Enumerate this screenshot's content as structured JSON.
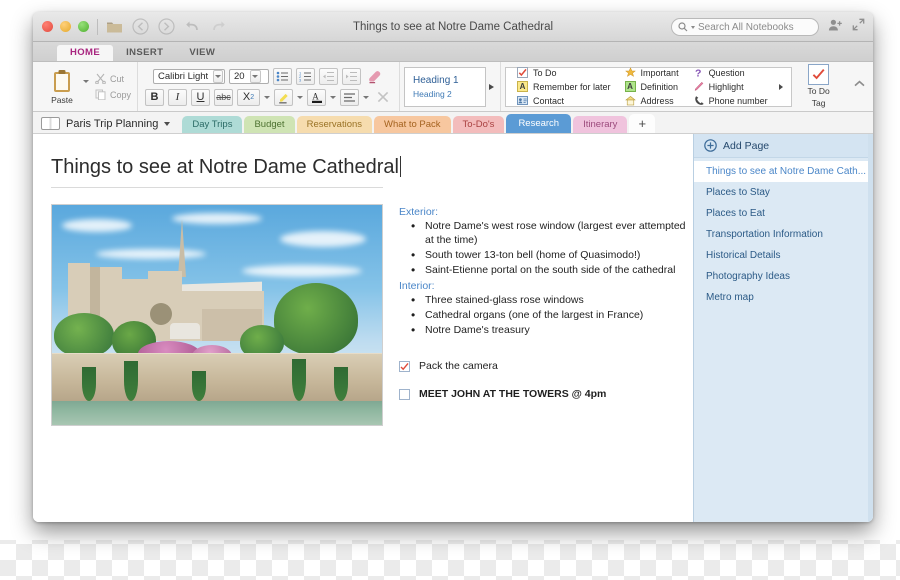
{
  "window": {
    "title": "Things to see at Notre Dame Cathedral",
    "traffic": {
      "close": "close-button",
      "minimize": "minimize-button",
      "maximize": "maximize-button"
    }
  },
  "titlebar": {
    "icons": [
      "open-notebook-icon",
      "back-icon",
      "forward-icon",
      "undo-icon",
      "redo-icon"
    ],
    "search": {
      "placeholder": "Search All Notebooks",
      "icon": "search-icon"
    },
    "share_icon": "share-person-icon",
    "fullscreen_icon": "expand-diagonal-icon"
  },
  "ribbon": {
    "tabs": [
      {
        "label": "HOME",
        "active": true
      },
      {
        "label": "INSERT",
        "active": false
      },
      {
        "label": "VIEW",
        "active": false
      }
    ],
    "collapse_icon": "chevron-up-icon",
    "clipboard": {
      "paste_label": "Paste",
      "paste_icon": "clipboard-icon",
      "cut_label": "Cut",
      "cut_icon": "scissors-icon",
      "copy_label": "Copy",
      "copy_icon": "copy-icon"
    },
    "font": {
      "family_value": "Calibri Light",
      "size_value": "20",
      "bold": "B",
      "italic": "I",
      "underline": "U",
      "strike": "abc",
      "subscript": "X",
      "subscript_sub": "2",
      "bullets_icon": "bulleted-list-icon",
      "numbering_icon": "numbered-list-icon",
      "outdent_icon": "decrease-indent-icon",
      "indent_icon": "increase-indent-icon",
      "eraser_icon": "clear-formatting-icon",
      "highlight_icon": "highlighter-icon",
      "fontcolor_icon": "font-color-icon",
      "align_icon": "align-left-icon",
      "clear_icon": "clear-all-icon"
    },
    "styles": {
      "heading1": "Heading 1",
      "heading2": "Heading 2",
      "scroll_icon": "gallery-more-icon"
    },
    "tags": {
      "columns": [
        [
          {
            "label": "To Do",
            "icon": "todo-checkbox-icon"
          },
          {
            "label": "Remember for later",
            "icon": "remember-letter-a-icon"
          },
          {
            "label": "Contact",
            "icon": "contact-card-icon"
          }
        ],
        [
          {
            "label": "Important",
            "icon": "star-icon"
          },
          {
            "label": "Definition",
            "icon": "definition-letter-a-icon"
          },
          {
            "label": "Address",
            "icon": "house-icon"
          }
        ],
        [
          {
            "label": "Question",
            "icon": "question-mark-icon"
          },
          {
            "label": "Highlight",
            "icon": "highlighter-pen-icon"
          },
          {
            "label": "Phone number",
            "icon": "phone-handset-icon"
          }
        ]
      ],
      "scroll_icon": "tag-more-icon",
      "todo_tag": {
        "line1": "To Do",
        "line2": "Tag",
        "icon": "red-checkmark-icon"
      }
    }
  },
  "notebook": {
    "name": "Paris Trip Planning",
    "icon": "notebook-icon",
    "caret_icon": "chevron-down-icon",
    "sections": [
      {
        "label": "Day Trips",
        "color": "#aedbd6",
        "text": "#2b6b66",
        "active": false
      },
      {
        "label": "Budget",
        "color": "#cfe4b4",
        "text": "#4d7230",
        "active": false
      },
      {
        "label": "Reservations",
        "color": "#f6dcae",
        "text": "#9a7326",
        "active": false
      },
      {
        "label": "What to Pack",
        "color": "#f7c79f",
        "text": "#a4621f",
        "active": false
      },
      {
        "label": "To-Do's",
        "color": "#f3bcbc",
        "text": "#a94141",
        "active": false
      },
      {
        "label": "Research",
        "color": "#5b9bd5",
        "text": "#ffffff",
        "active": true
      },
      {
        "label": "Itinerary",
        "color": "#f0c3dd",
        "text": "#9c4b7d",
        "active": false
      }
    ],
    "add_section_label": "+"
  },
  "page": {
    "title": "Things to see at Notre Dame Cathedral",
    "photo_name": "notre-dame-cathedral-photo",
    "sections": [
      {
        "heading": "Exterior:",
        "items": [
          "Notre Dame's west rose window (largest ever attempted at the time)",
          "South tower 13-ton bell (home of Quasimodo!)",
          "Saint-Etienne portal on the south side of the cathedral"
        ]
      },
      {
        "heading": "Interior:",
        "items": [
          "Three stained-glass rose windows",
          "Cathedral organs (one of the largest in France)",
          "Notre Dame's treasury"
        ]
      }
    ],
    "todos": [
      {
        "label": "Pack the camera",
        "checked": true,
        "bold": false
      },
      {
        "label": "MEET JOHN AT THE TOWERS @ 4pm",
        "checked": false,
        "bold": true
      }
    ]
  },
  "pages_panel": {
    "add_page_label": "Add Page",
    "add_page_icon": "plus-circle-icon",
    "items": [
      {
        "label": "Things to see at Notre Dame Cath...",
        "selected": true
      },
      {
        "label": "Places to Stay",
        "selected": false
      },
      {
        "label": "Places to Eat",
        "selected": false
      },
      {
        "label": "Transportation Information",
        "selected": false
      },
      {
        "label": "Historical Details",
        "selected": false
      },
      {
        "label": "Photography Ideas",
        "selected": false
      },
      {
        "label": "Metro map",
        "selected": false
      }
    ]
  },
  "colors": {
    "accent_blue": "#5b9bd5",
    "active_tab_text": "#a8257f",
    "panel_blue": "#dce9f4",
    "heading_blue": "#4a86c8",
    "todo_red": "#e04b3a"
  }
}
